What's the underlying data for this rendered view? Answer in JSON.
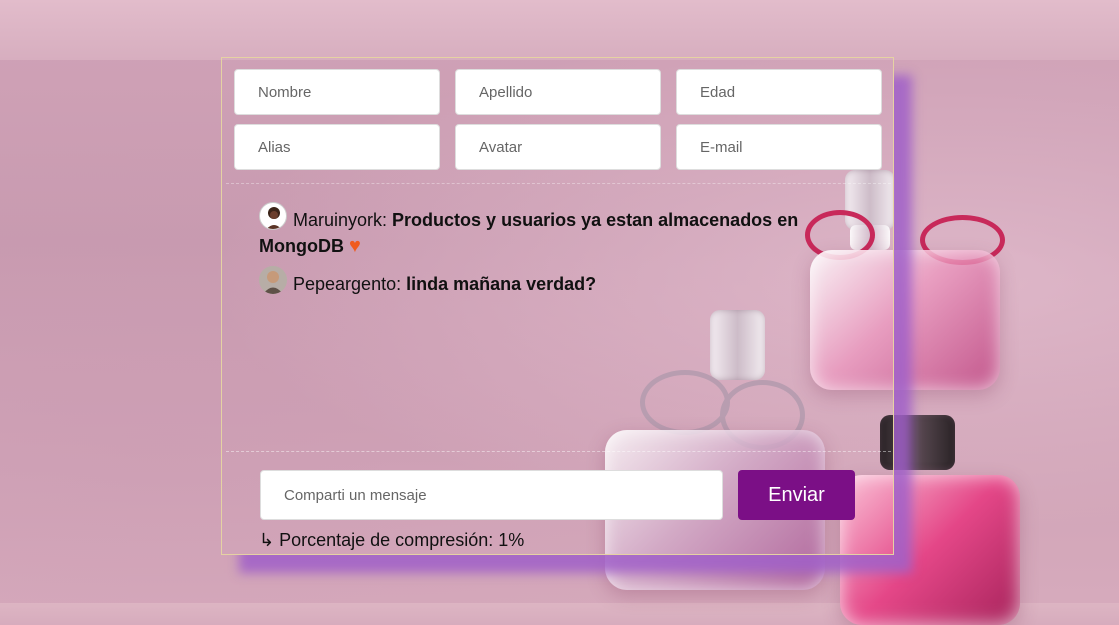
{
  "form": {
    "nombre_placeholder": "Nombre",
    "apellido_placeholder": "Apellido",
    "edad_placeholder": "Edad",
    "alias_placeholder": "Alias",
    "avatar_placeholder": "Avatar",
    "email_placeholder": "E-mail"
  },
  "messages": [
    {
      "user": "Maruinyork:",
      "text": "Productos y usuarios ya estan almacenados en MongoDB",
      "emoji": "♥",
      "avatar_icon": "woman-avatar-icon"
    },
    {
      "user": "Pepeargento:",
      "text": "linda mañana verdad?",
      "avatar_icon": "man-avatar-icon"
    }
  ],
  "chat": {
    "input_placeholder": "Comparti un mensaje",
    "send_label": "Enviar"
  },
  "compression": {
    "glyph": "↳",
    "label": "Porcentaje de compresión: 1%"
  },
  "colors": {
    "send_button": "#7b0f86",
    "panel_shadow": "#a05fc8",
    "heart": "#f05a1e"
  }
}
